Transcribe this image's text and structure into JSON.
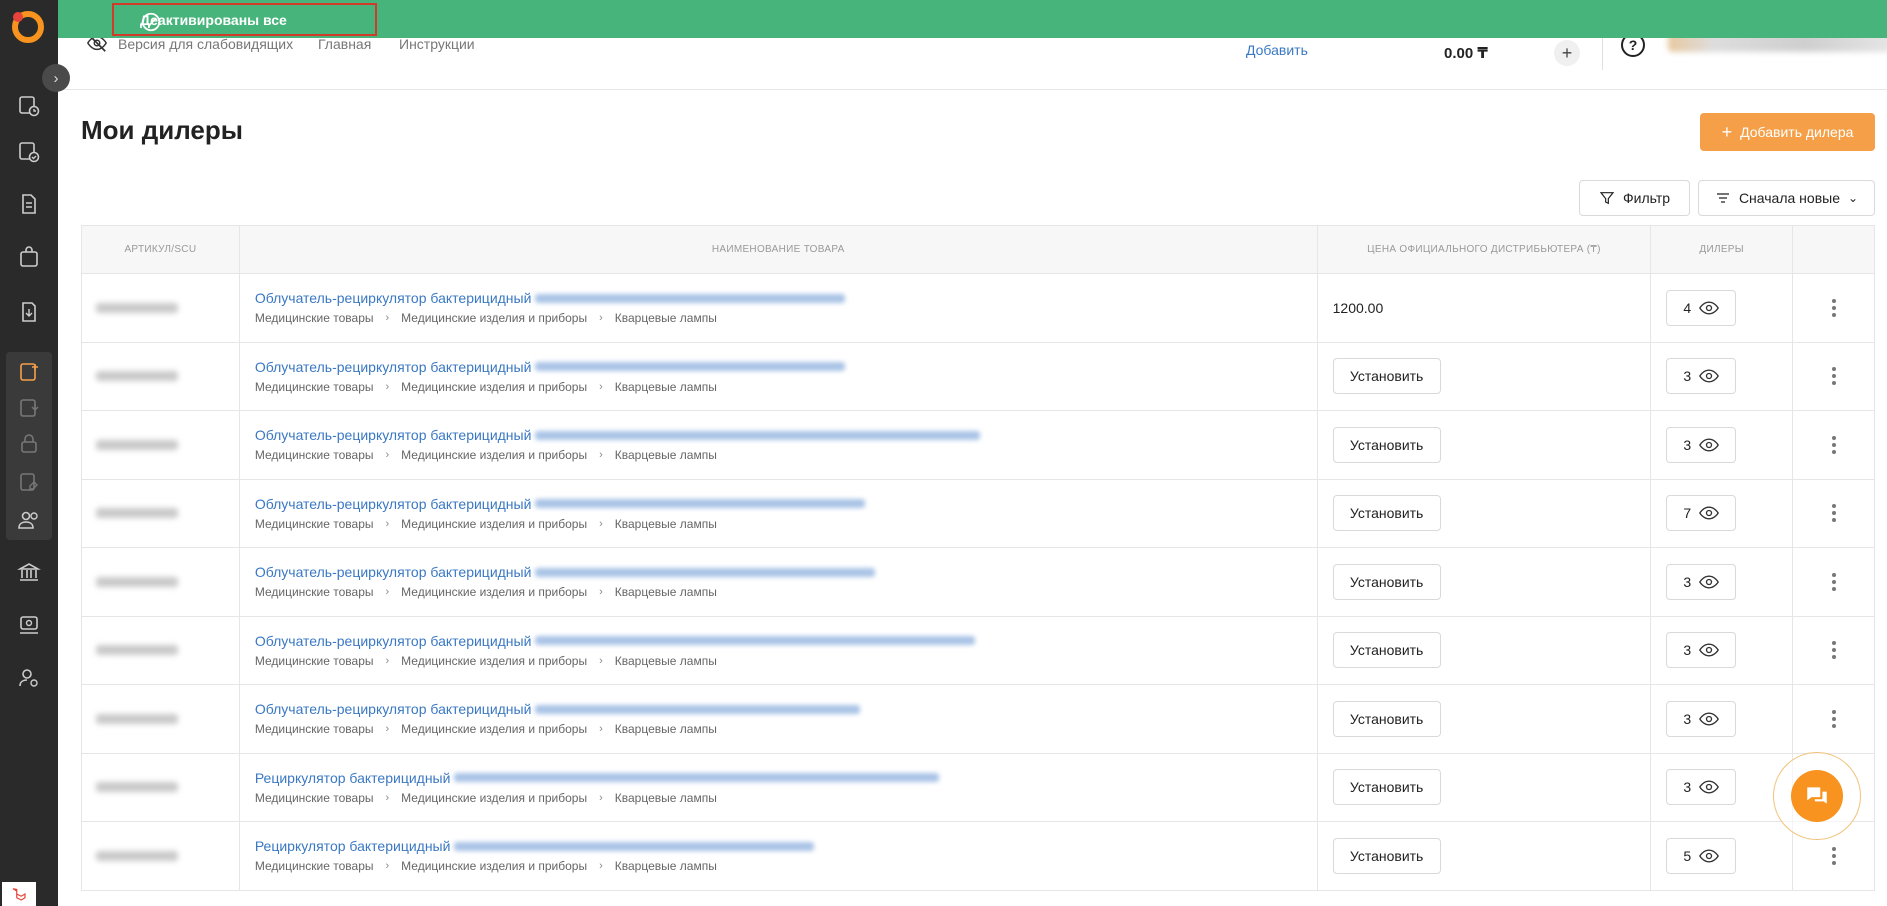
{
  "toast": {
    "message": "Деактивированы все"
  },
  "header": {
    "links": [
      "Версия для слабовидящих",
      "Главная",
      "Инструкции"
    ],
    "add_label": "Добавить",
    "balance": "0.00 ₸"
  },
  "page": {
    "title": "Мои дилеры",
    "add_dealer": "Добавить дилера",
    "filter": "Фильтр",
    "sort": "Сначала новые"
  },
  "table": {
    "columns": [
      "Артикул/SCU",
      "Наименование товара",
      "Цена официального дистрибьютера (₸)",
      "Дилеры",
      ""
    ],
    "breadcrumb": [
      "Медицинские товары",
      "Медицинские изделия и приборы",
      "Кварцевые лампы"
    ],
    "set_label": "Установить",
    "rows": [
      {
        "name": "Облучатель-рециркулятор бактерицидный",
        "price": "1200.00",
        "dealers": "4"
      },
      {
        "name": "Облучатель-рециркулятор бактерицидный",
        "price": "",
        "dealers": "3"
      },
      {
        "name": "Облучатель-рециркулятор бактерицидный",
        "price": "",
        "dealers": "3"
      },
      {
        "name": "Облучатель-рециркулятор бактерицидный",
        "price": "",
        "dealers": "7"
      },
      {
        "name": "Облучатель-рециркулятор бактерицидный",
        "price": "",
        "dealers": "3"
      },
      {
        "name": "Облучатель-рециркулятор бактерицидный",
        "price": "",
        "dealers": "3"
      },
      {
        "name": "Облучатель-рециркулятор бактерицидный",
        "price": "",
        "dealers": "3"
      },
      {
        "name": "Рециркулятор бактерицидный",
        "price": "",
        "dealers": "3"
      },
      {
        "name": "Рециркулятор бактерицидный",
        "price": "",
        "dealers": "5"
      }
    ]
  },
  "colors": {
    "accent": "#f5a049",
    "toast": "#47b57b",
    "link": "#3a78c3",
    "sidebar": "#2a2a2a"
  }
}
